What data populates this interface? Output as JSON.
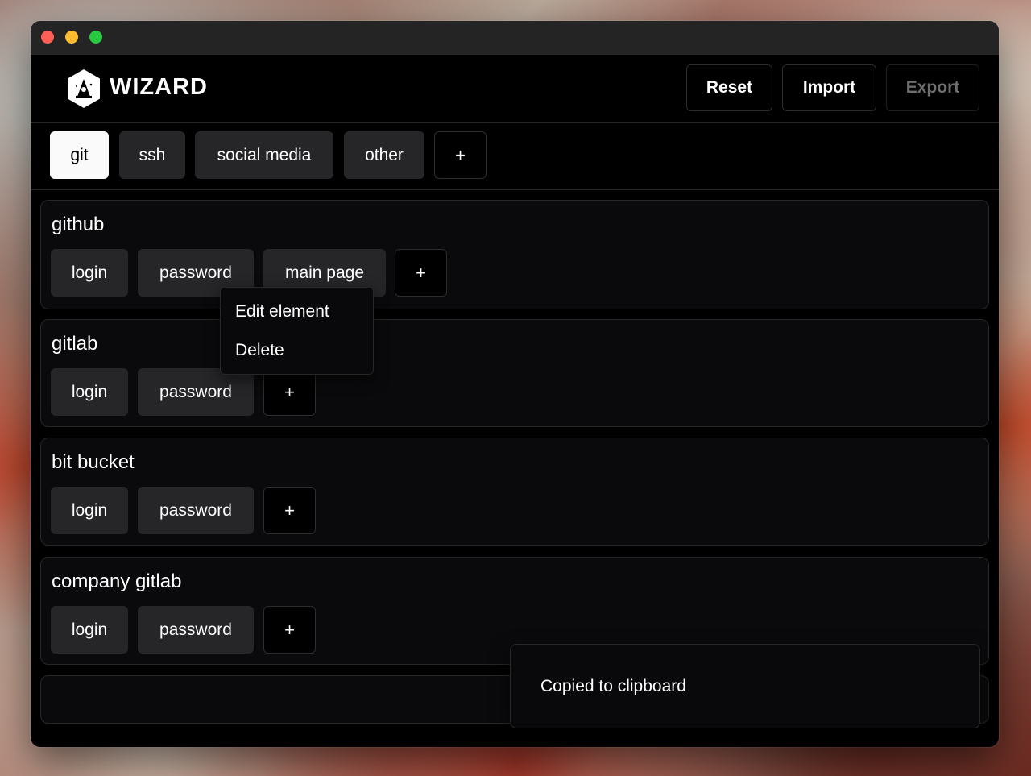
{
  "app": {
    "name": "WIZARD",
    "header_buttons": {
      "reset": "Reset",
      "import": "Import",
      "export": "Export"
    }
  },
  "tabs": [
    {
      "label": "git",
      "active": true
    },
    {
      "label": "ssh",
      "active": false
    },
    {
      "label": "social media",
      "active": false
    },
    {
      "label": "other",
      "active": false
    }
  ],
  "add_symbol": "+",
  "groups": [
    {
      "title": "github",
      "elements": [
        "login",
        "password",
        "main page"
      ]
    },
    {
      "title": "gitlab",
      "elements": [
        "login",
        "password"
      ]
    },
    {
      "title": "bit bucket",
      "elements": [
        "login",
        "password"
      ]
    },
    {
      "title": "company gitlab",
      "elements": [
        "login",
        "password"
      ]
    }
  ],
  "context_menu": {
    "items": [
      "Edit element",
      "Delete"
    ]
  },
  "toast": {
    "message": "Copied to clipboard"
  },
  "colors": {
    "window_bg": "#000000",
    "button_bg": "#262629",
    "active_tab_bg": "#fafafa",
    "border": "#27272a",
    "close": "#fe5f57",
    "minimize": "#febc2e",
    "maximize": "#28c840"
  }
}
